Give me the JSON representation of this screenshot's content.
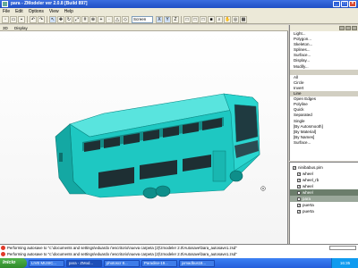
{
  "window": {
    "title": "para - ZModeler ver 2.0.8 [Build 897]"
  },
  "menu": [
    "File",
    "Edit",
    "Options",
    "View",
    "Help"
  ],
  "toolbar": {
    "mode_select": "Screen"
  },
  "viewport_header": {
    "mode": "3D",
    "label": "Display"
  },
  "right_menu": [
    "Light...",
    "Polygon...",
    "Skeleton...",
    "Splines...",
    "Surface...",
    "Display...",
    "Modify...",
    "",
    "All",
    "Circle",
    "Invert",
    "Line",
    "Open Edges",
    "Polyline",
    "Quick",
    "Separated",
    "Single",
    "[By Autosmooth]",
    "[By Material]",
    "[By Names]",
    "Surface..."
  ],
  "tree": [
    {
      "label": "ninibabus.pim",
      "checked": true,
      "state": ""
    },
    {
      "label": "wheel",
      "checked": true,
      "state": ""
    },
    {
      "label": "wheel_rb",
      "checked": true,
      "state": ""
    },
    {
      "label": "wheel",
      "checked": true,
      "state": ""
    },
    {
      "label": "wheel",
      "checked": true,
      "state": "sel"
    },
    {
      "label": "para",
      "checked": true,
      "state": "sel2"
    },
    {
      "label": "puerta",
      "checked": true,
      "state": ""
    },
    {
      "label": "puerta",
      "checked": true,
      "state": ""
    }
  ],
  "log": [
    "Performing autosave to \"c:\\documents and settings\\eduardo r\\escritorio\\nueva carpeta (2)\\zmodeler 2.0\\Autosave\\bara_autosave1.zsd\"",
    "Performing autosave to \"c:\\documents and settings\\eduardo r\\escritorio\\nueva carpeta (2)\\zmodeler 2.0\\Autosave\\bara_autosave1.zsd\""
  ],
  "taskbar": {
    "start": "Inicio",
    "tasks": [
      "LIVE MUSIC...",
      "para - ZMod...",
      "photoscr 8...",
      "Paradise-19...",
      "jomadbus18..."
    ],
    "active_task": 1,
    "clock": "16:35"
  },
  "colors": {
    "bus_body": "#1ec8c2",
    "bus_dark": "#0e8e8a",
    "viewport_bg": "#ffffff",
    "titlebar": "#245edb"
  }
}
